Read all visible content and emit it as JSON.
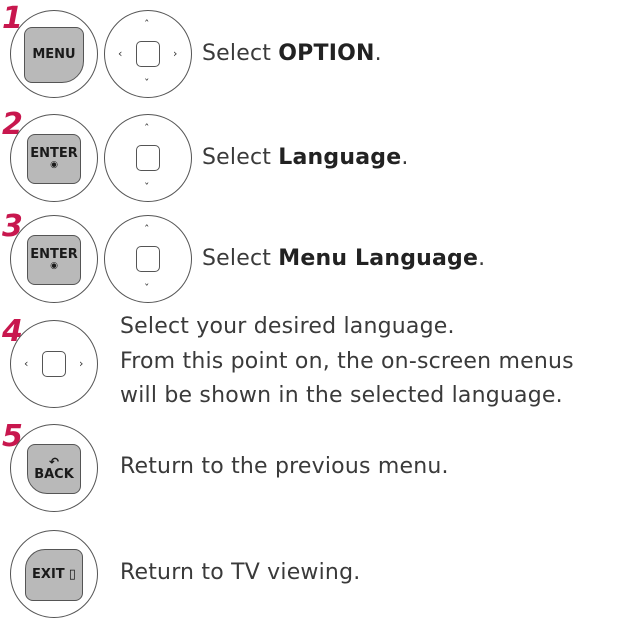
{
  "steps": [
    {
      "number": "1",
      "key": "MENU",
      "text_prefix": "Select ",
      "text_bold": "OPTION",
      "text_suffix": "."
    },
    {
      "number": "2",
      "key": "ENTER",
      "text_prefix": "Select ",
      "text_bold": "Language",
      "text_suffix": "."
    },
    {
      "number": "3",
      "key": "ENTER",
      "text_prefix": "Select ",
      "text_bold": "Menu Language",
      "text_suffix": "."
    },
    {
      "number": "4",
      "line1": "Select your desired language.",
      "line2": "From this point on, the on-screen menus",
      "line3": "will be shown in the selected language."
    },
    {
      "number": "5",
      "key": "BACK",
      "text": "Return to the previous menu."
    },
    {
      "key": "EXIT",
      "text": "Return to TV viewing."
    }
  ],
  "enter_dot": "◉",
  "colors": {
    "step_number": "#c8174e",
    "key_fill": "#b9b9b9",
    "outline": "#555555"
  }
}
